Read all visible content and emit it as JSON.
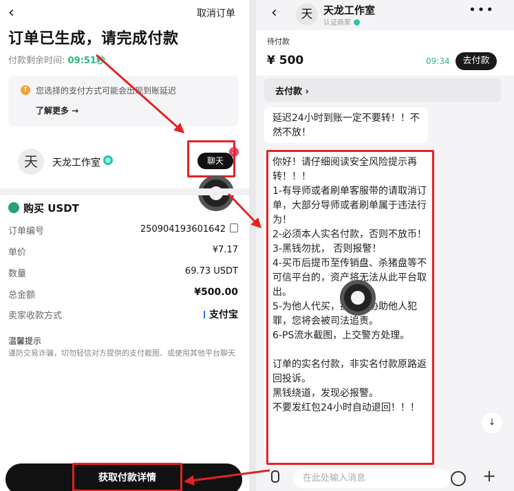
{
  "order_screen": {
    "back_glyph": "‹",
    "cancel_label": "取消订单",
    "title": "订单已生成，请完成付款",
    "timer_label": "付款剩余时间:",
    "timer_value": "09:51秒",
    "notice_icon": "warning-icon",
    "notice_text": "您选择的支付方式可能会出现到账延迟",
    "learn_more": "了解更多 →",
    "seller_avatar": "天",
    "seller_name": "天龙工作室",
    "chat_label": "聊天",
    "chat_badge": "2",
    "buy_title": "购买 USDT",
    "details": [
      {
        "label": "订单编号",
        "value": "250904193601642"
      },
      {
        "label": "单价",
        "value": "¥7.17"
      },
      {
        "label": "数量",
        "value": "69.73 USDT"
      },
      {
        "label": "总金额",
        "value": "¥500.00"
      },
      {
        "label": "卖家收款方式",
        "value": "支付宝"
      }
    ],
    "tips_title": "温馨提示",
    "tips_text": "谨防交易诈骗，切勿轻信对方提供的支付截图、或使用其他平台聊天",
    "bottom_button": "获取付款详情"
  },
  "chat_screen": {
    "back_glyph": "‹",
    "avatar": "天",
    "name": "天龙工作室",
    "subtitle": "认证商家",
    "more_glyph": "•••",
    "pay_label": "待付款",
    "pay_amount": "¥ 500",
    "pay_timer": "09:34",
    "pay_button": "去付款",
    "quick_pay": "去付款  ›",
    "message_1": "延迟24小时到账一定不要转！！不然不放！",
    "message_2": "你好！请仔细阅读安全风险提示再转！！！\n1-有导师或者刷单客服带的请取消订单，大部分导师或者刷单属于违法行为！\n2-必须本人实名付款，否则不放币！\n3-黑钱勿扰， 否则报警！\n4-买币后提币至传销盘、杀猪盘等不可信平台的，资产将无法从此平台取出。\n5-为他人代买，提币，协助他人犯罪，您将会被司法追责。\n 6-PS流水截图，上交警方处理。\n\n订单的实名付款，非实名付款原路返回投诉。\n黑钱绕道，发现必报警。\n不要发红包24小时自动退回！！！",
    "scroll_glyph": "↓",
    "input_placeholder": "在此处输入消息",
    "plus_glyph": "+"
  },
  "colors": {
    "annotation": "#e32222",
    "accent_green": "#2cb67d",
    "dark_button": "#111111"
  }
}
